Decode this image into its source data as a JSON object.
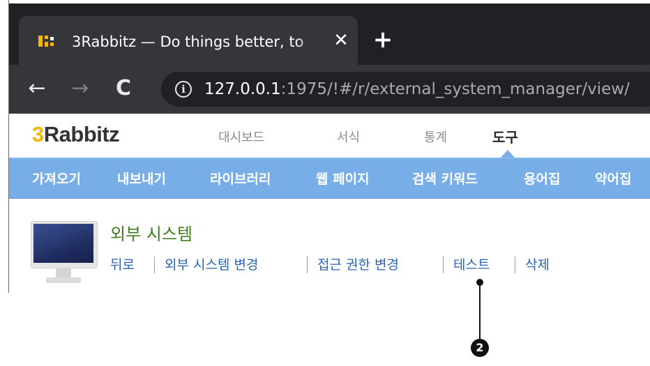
{
  "browser": {
    "tab": {
      "title": "3Rabbitz — Do things better, to",
      "close_glyph": "✕",
      "favicon_colors": [
        "#f2b705",
        "#ffffff"
      ]
    },
    "new_tab_glyph": "+",
    "toolbar": {
      "back_glyph": "←",
      "forward_glyph": "→",
      "reload_glyph": "C"
    },
    "address": {
      "info_glyph": "i",
      "host": "127.0.0.1",
      "rest": ":1975/!#/r/external_system_manager/view/"
    }
  },
  "app": {
    "logo": {
      "prefix": "3",
      "name": "Rabbitz"
    },
    "menu": [
      "대시보드",
      "서식",
      "통계",
      "도구"
    ],
    "active_menu": "도구",
    "submenu": [
      "가져오기",
      "내보내기",
      "라이브러리",
      "웹 페이지",
      "검색 키워드",
      "용어집",
      "약어집"
    ],
    "accent_color": "#78aee8"
  },
  "content": {
    "title": "외부 시스템",
    "actions": [
      "뒤로",
      "외부 시스템 변경",
      "접근 권한 변경",
      "테스트",
      "삭제"
    ],
    "icon": "monitor-icon"
  },
  "annotation": {
    "label": "2"
  }
}
